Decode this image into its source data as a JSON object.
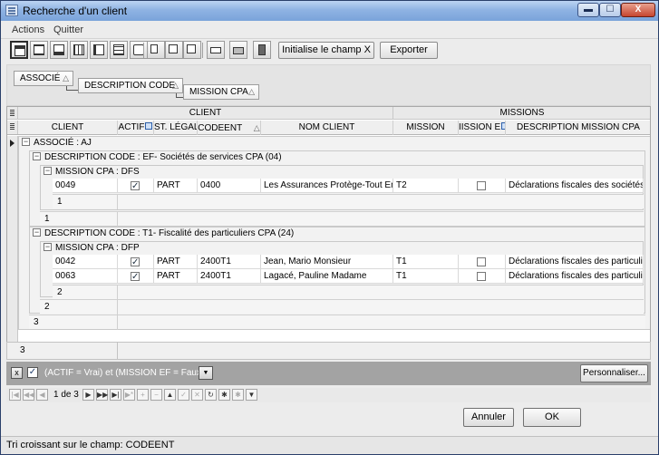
{
  "window": {
    "title": "Recherche d'un client",
    "min": "▬",
    "max": "☐",
    "close": "X"
  },
  "menu": {
    "actions": "Actions",
    "quit": "Quitter"
  },
  "toolbar": {
    "init_label": "Initialise le champ X",
    "export_label": "Exporter"
  },
  "group_by": {
    "level1": "ASSOCIÉ",
    "level2": "DESCRIPTION CODE",
    "level3": "MISSION CPA",
    "sort_glyph": "△"
  },
  "bands": {
    "client": "CLIENT",
    "missions": "MISSIONS"
  },
  "columns": {
    "client": "CLIENT",
    "actif": "ACTIF",
    "st_legal": "ST. LÉGAL",
    "codeent": "CODEENT",
    "nom_client": "NOM CLIENT",
    "mission": "MISSION",
    "mission_ef": "IISSION E",
    "desc_mission": "DESCRIPTION MISSION CPA",
    "sort_glyph": "△"
  },
  "groups": {
    "associe": "ASSOCIÉ : AJ",
    "desc1": "DESCRIPTION CODE : EF- Sociétés de services CPA (04)",
    "mission1": "MISSION CPA : DFS",
    "desc2": "DESCRIPTION CODE : T1- Fiscalité des particuliers CPA (24)",
    "mission2": "MISSION CPA : DFP",
    "expander": "−"
  },
  "rows1": [
    {
      "client": "0049",
      "actif": true,
      "st": "PART",
      "codeent": "0400",
      "nom": "Les Assurances Protège-Tout Enr.",
      "mission": "T2",
      "ef": false,
      "desc": "Déclarations fiscales des sociétés"
    }
  ],
  "rows2": [
    {
      "client": "0042",
      "actif": true,
      "st": "PART",
      "codeent": "2400T1",
      "nom": "Jean, Mario Monsieur",
      "mission": "T1",
      "ef": false,
      "desc": "Déclarations fiscales des particuliers"
    },
    {
      "client": "0063",
      "actif": true,
      "st": "PART",
      "codeent": "2400T1",
      "nom": "Lagacé, Pauline Madame",
      "mission": "T1",
      "ef": false,
      "desc": "Déclarations fiscales des particuliers"
    }
  ],
  "summaries": {
    "mission1": "1",
    "desc1": "1",
    "mission2": "2",
    "desc2": "2",
    "associe": "3",
    "total": "3"
  },
  "filter": {
    "text": "(ACTIF = Vrai) et (MISSION EF = Faux)",
    "close": "x",
    "check": "✓",
    "dropdown": "▼",
    "customize": "Personnaliser..."
  },
  "nav": {
    "page": "1 de 3",
    "buttons": [
      "|◀",
      "◀◀",
      "◀",
      "▶",
      "▶▶",
      "▶|",
      "▶*",
      "+",
      "−",
      "▲",
      "✓",
      "✕",
      "↻",
      "✱",
      "✱",
      "▼"
    ]
  },
  "dialog": {
    "cancel": "Annuler",
    "ok": "OK"
  },
  "status": {
    "text": "Tri croissant sur le champ: CODEENT"
  }
}
